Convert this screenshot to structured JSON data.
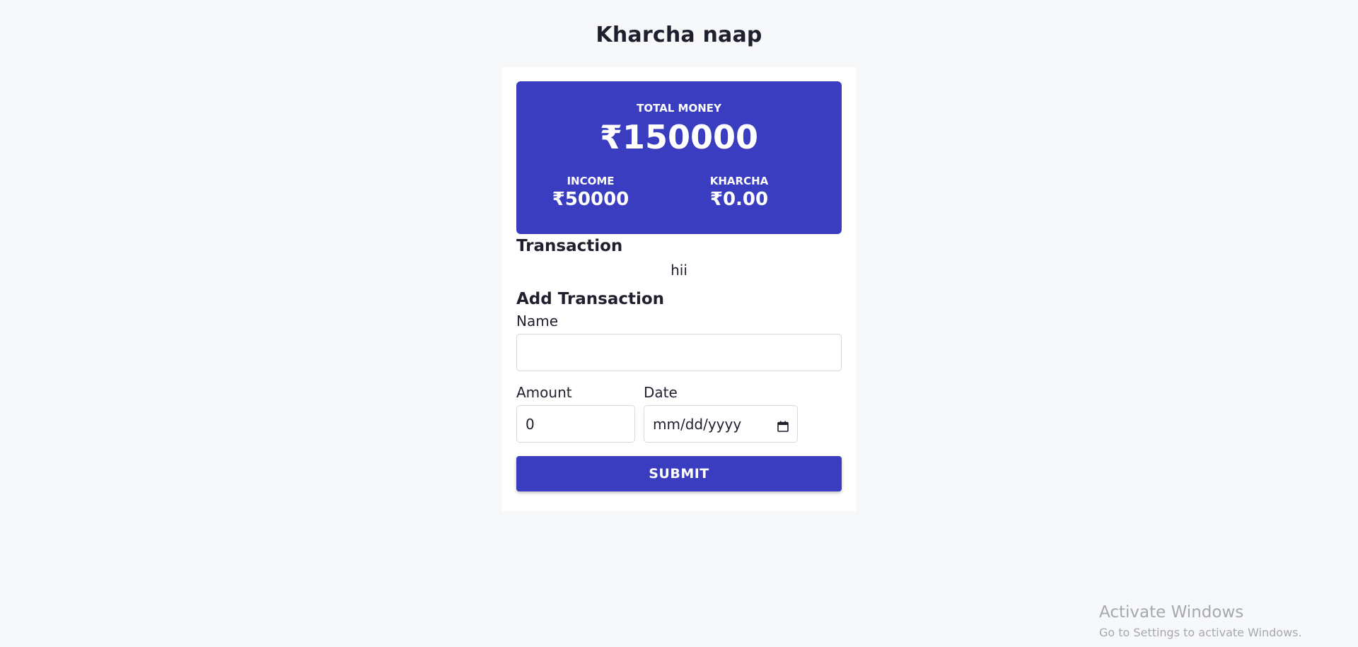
{
  "app": {
    "title": "Kharcha naap"
  },
  "balance": {
    "total_label": "TOTAL MONEY",
    "total_value": "₹150000",
    "income_label": "INCOME",
    "income_value": "₹50000",
    "kharcha_label": "KHARCHA",
    "kharcha_value": "₹0.00",
    "color": "#3a3dc0"
  },
  "transactions": {
    "heading": "Transaction",
    "items": [
      "hii"
    ]
  },
  "add_transaction": {
    "heading": "Add Transaction",
    "name_label": "Name",
    "name_value": "",
    "amount_label": "Amount",
    "amount_value": "0",
    "date_label": "Date",
    "date_placeholder": "mm/dd/yyyy",
    "date_icon": "calendar-icon",
    "submit_label": "SUBMIT"
  },
  "watermark": {
    "title": "Activate Windows",
    "subtitle": "Go to Settings to activate Windows."
  }
}
